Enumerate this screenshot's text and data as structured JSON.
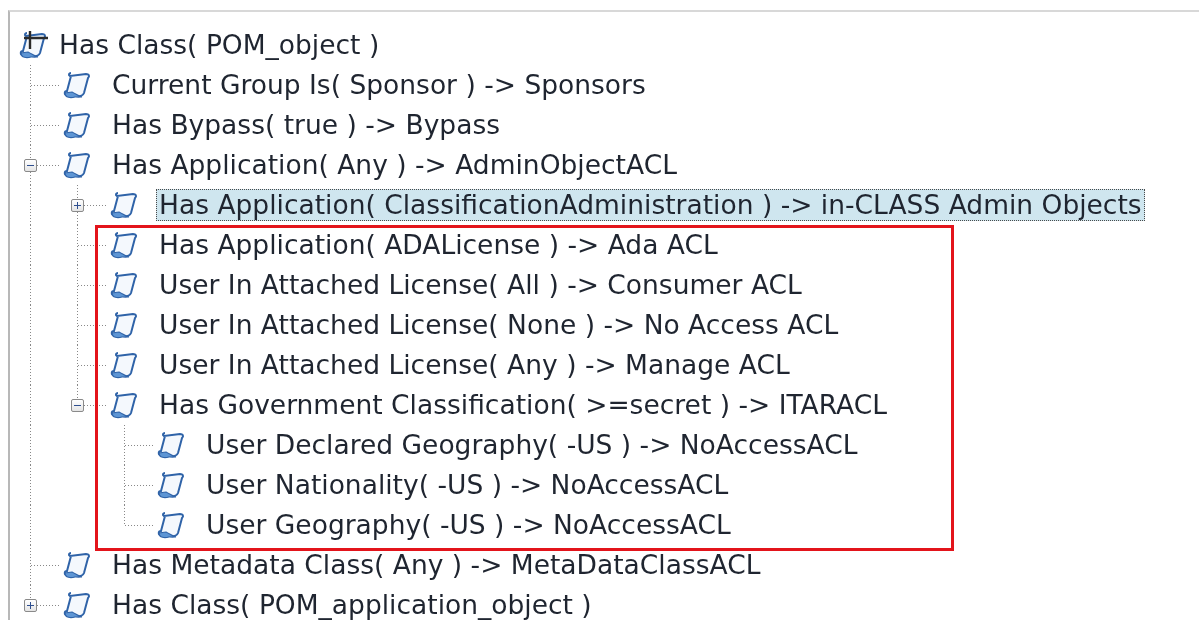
{
  "tree": {
    "label": "Has Class( POM_object )",
    "kind": "root",
    "selected": false,
    "highlighted": false,
    "children": [
      {
        "label": "Current Group Is( Sponsor ) -> Sponsors",
        "kind": "rule",
        "selected": false,
        "highlighted": false
      },
      {
        "label": "Has Bypass( true ) -> Bypass",
        "kind": "rule",
        "selected": false,
        "highlighted": false
      },
      {
        "label": "Has Application( Any ) -> AdminObjectACL",
        "kind": "rule",
        "selected": false,
        "highlighted": false,
        "expanded": true,
        "children": [
          {
            "label": "Has Application( ClassificationAdministration ) -> in-CLASS Admin Objects",
            "kind": "rule",
            "selected": true,
            "highlighted": false,
            "expanded": false
          },
          {
            "label": "Has Application( ADALicense ) -> Ada ACL",
            "kind": "rule",
            "selected": false,
            "highlighted": true
          },
          {
            "label": "User In Attached License( All ) -> Consumer ACL",
            "kind": "rule",
            "selected": false,
            "highlighted": true
          },
          {
            "label": "User In Attached License( None ) -> No Access ACL",
            "kind": "rule",
            "selected": false,
            "highlighted": true
          },
          {
            "label": "User In Attached License( Any ) -> Manage ACL",
            "kind": "rule",
            "selected": false,
            "highlighted": true
          },
          {
            "label": "Has Government Classification( >=secret ) -> ITARACL",
            "kind": "rule",
            "selected": false,
            "highlighted": true,
            "expanded": true,
            "children": [
              {
                "label": "User Declared Geography( -US ) -> NoAccessACL",
                "kind": "rule",
                "selected": false,
                "highlighted": true
              },
              {
                "label": "User Nationality( -US ) -> NoAccessACL",
                "kind": "rule",
                "selected": false,
                "highlighted": true
              },
              {
                "label": "User Geography( -US ) -> NoAccessACL",
                "kind": "rule",
                "selected": false,
                "highlighted": true
              }
            ]
          }
        ]
      },
      {
        "label": "Has Metadata Class( Any ) -> MetaDataClassACL",
        "kind": "rule",
        "selected": false,
        "highlighted": false
      },
      {
        "label": "Has Class( POM_application_object )",
        "kind": "rule",
        "selected": false,
        "highlighted": false,
        "expanded": false
      }
    ]
  }
}
